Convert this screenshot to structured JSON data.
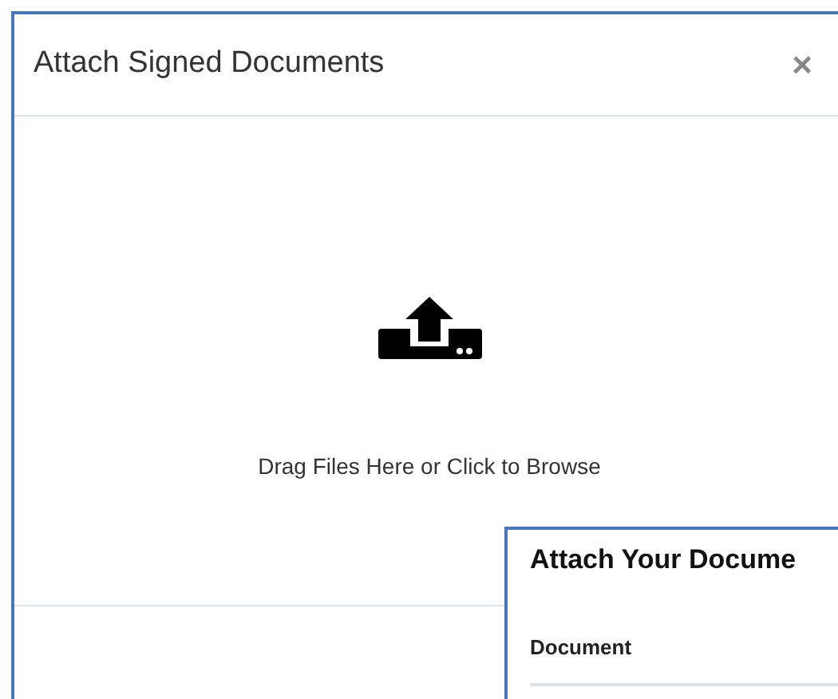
{
  "dialog": {
    "title": "Attach Signed Documents",
    "close": "×",
    "dropzone_text": "Drag Files Here or Click to Browse"
  },
  "overlay_panel": {
    "title": "Attach Your Docume",
    "column_header": "Document"
  }
}
